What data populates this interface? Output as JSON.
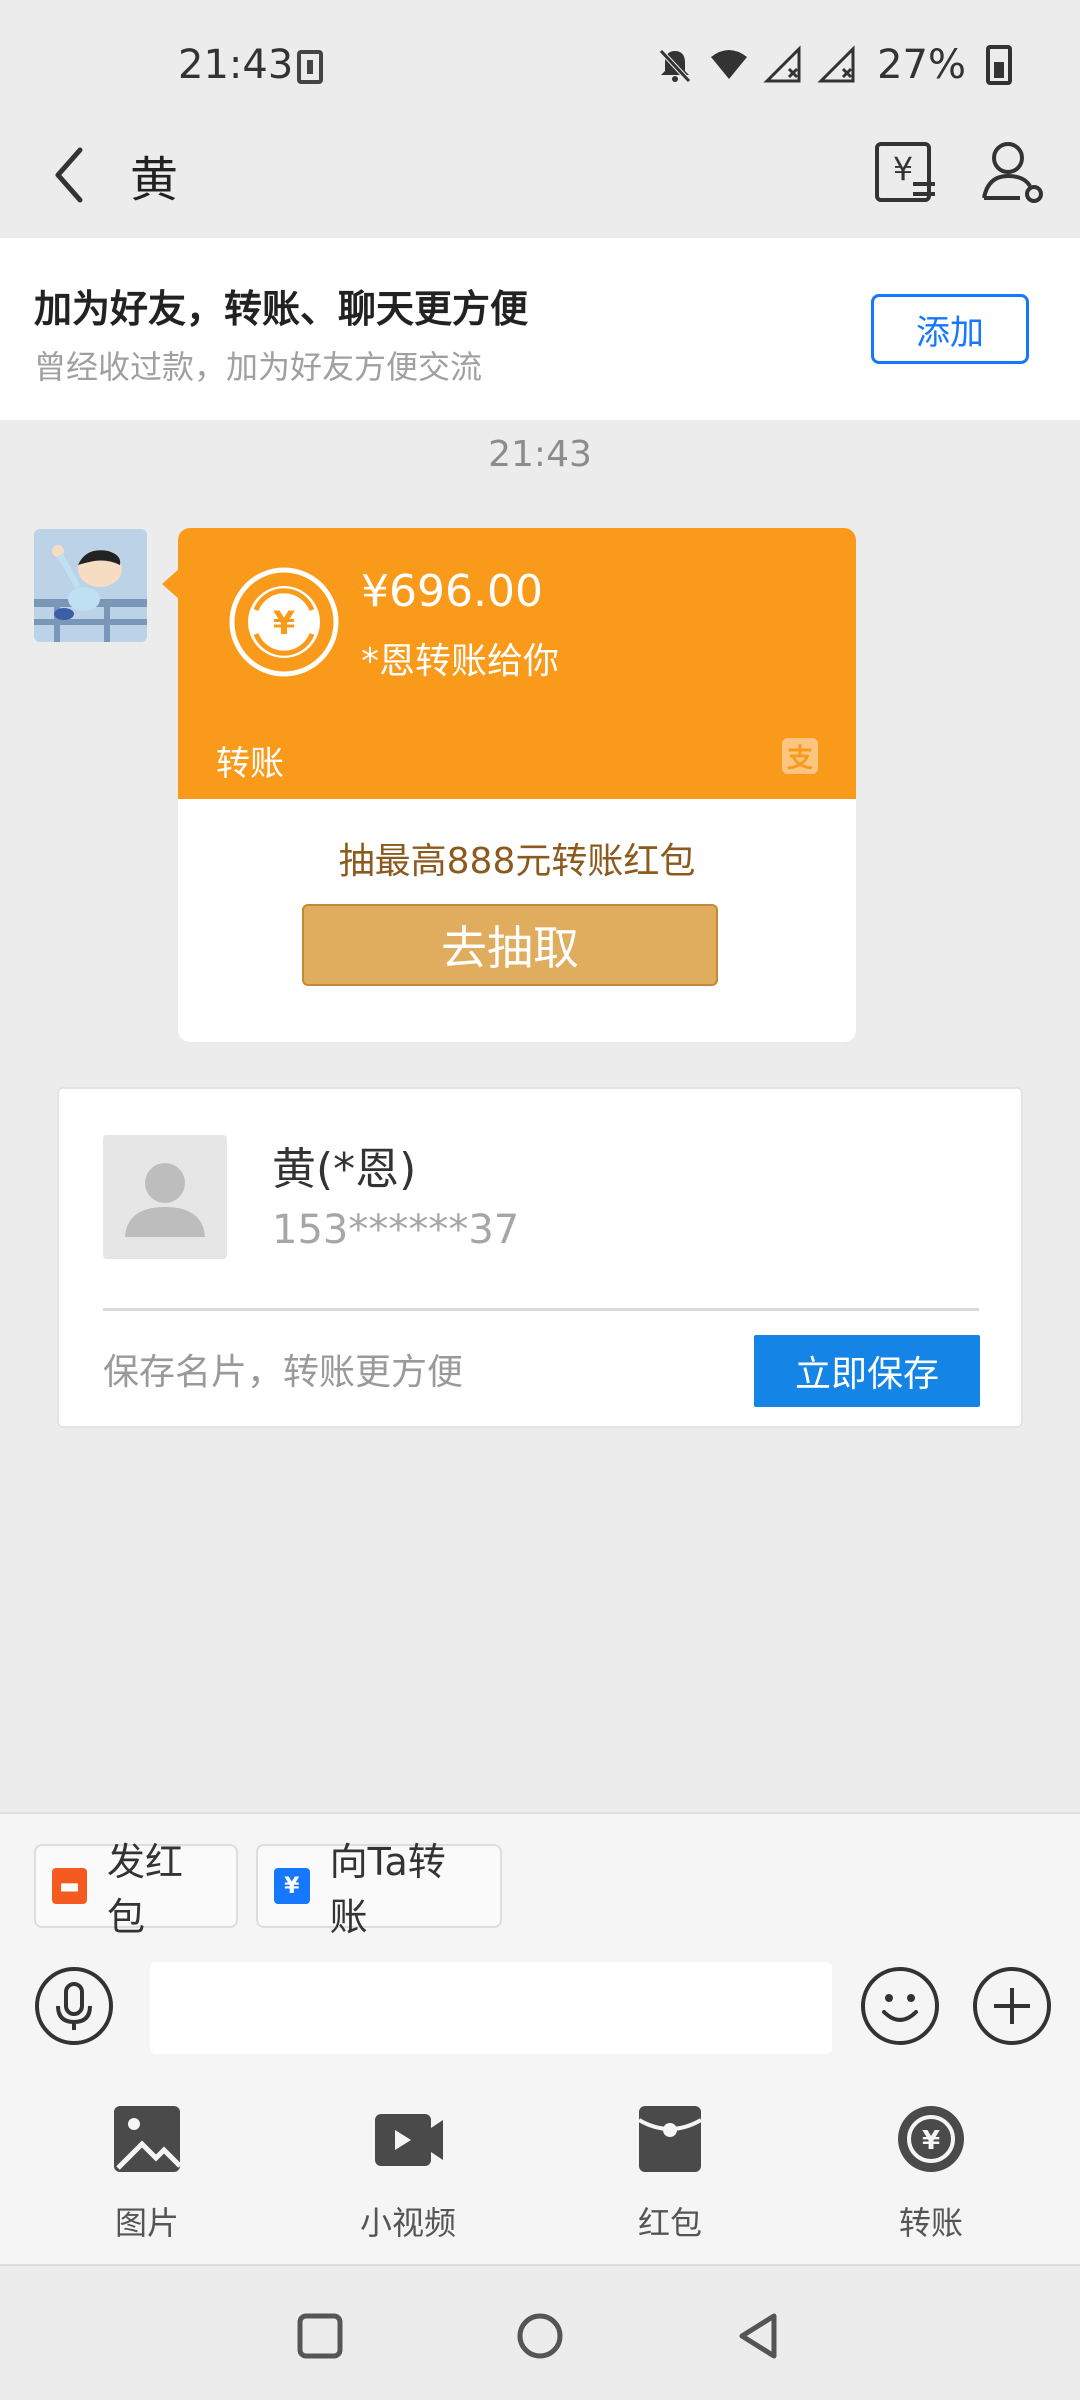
{
  "status_bar": {
    "time": "21:43",
    "battery": "27%",
    "icons": [
      "download-icon",
      "bell-off-icon",
      "wifi-icon",
      "signal-icon",
      "signal-icon",
      "battery-charging-icon"
    ]
  },
  "header": {
    "title": "黄",
    "icons": [
      "back-arrow-icon",
      "bill-icon",
      "user-profile-icon"
    ]
  },
  "banner": {
    "title": "加为好友，转账、聊天更方便",
    "subtitle": "曾经收过款，加为好友方便交流",
    "add_label": "添加"
  },
  "message_time": "21:43",
  "transfer_card": {
    "amount": "¥696.00",
    "note": "*恩转账给你",
    "label": "转账",
    "alipay_glyph": "支",
    "promo": "抽最高888元转账红包",
    "draw_label": "去抽取",
    "colors": {
      "header": "#fa9a1a",
      "button": "#e0ad5e"
    }
  },
  "contact_card": {
    "name": "黄(*恩)",
    "phone": "153******37",
    "tip": "保存名片，转账更方便",
    "save_label": "立即保存",
    "accent": "#1485e6"
  },
  "quick_actions": [
    {
      "label": "发红包",
      "icon": "red-packet-icon"
    },
    {
      "label": "向Ta转账",
      "icon": "transfer-card-icon"
    }
  ],
  "input": {
    "placeholder": "",
    "value": ""
  },
  "toolbar": [
    {
      "label": "图片",
      "icon": "image-icon"
    },
    {
      "label": "小视频",
      "icon": "video-icon"
    },
    {
      "label": "红包",
      "icon": "red-packet-icon"
    },
    {
      "label": "转账",
      "icon": "transfer-icon"
    }
  ],
  "nav": [
    "recent-apps-icon",
    "home-icon",
    "back-icon"
  ]
}
